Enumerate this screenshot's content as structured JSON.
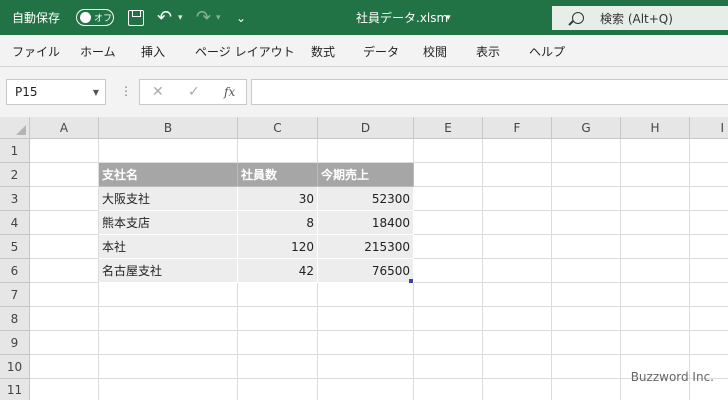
{
  "titlebar": {
    "autosave_label": "自動保存",
    "autosave_state": "オフ",
    "undo_icon": "↶",
    "redo_icon": "↷",
    "qat_more": "⩤",
    "filename": "社員データ.xlsm",
    "filename_dd": "▾",
    "search_label": "検索 (Alt+Q)"
  },
  "menu": [
    "ファイル",
    "ホーム",
    "挿入",
    "ページ レイアウト",
    "数式",
    "データ",
    "校閲",
    "表示",
    "ヘルプ"
  ],
  "formula_bar": {
    "name_box": "P15",
    "cancel_icon": "✕",
    "enter_icon": "✓",
    "fx_label": "fx",
    "formula": ""
  },
  "grid": {
    "columns": [
      "A",
      "B",
      "C",
      "D",
      "E",
      "F",
      "G",
      "H",
      "I"
    ],
    "rows": [
      "1",
      "2",
      "3",
      "4",
      "5",
      "6",
      "7",
      "8",
      "9",
      "10",
      "11"
    ],
    "table": {
      "headers": [
        "支社名",
        "社員数",
        "今期売上"
      ],
      "rows": [
        [
          "大阪支社",
          "30",
          "52300"
        ],
        [
          "熊本支店",
          "8",
          "18400"
        ],
        [
          "本社",
          "120",
          "215300"
        ],
        [
          "名古屋支社",
          "42",
          "76500"
        ]
      ]
    }
  },
  "watermark": "Buzzword Inc.",
  "colors": {
    "excel_green": "#217346",
    "table_header": "#a6a6a6",
    "table_body": "#ededed"
  }
}
